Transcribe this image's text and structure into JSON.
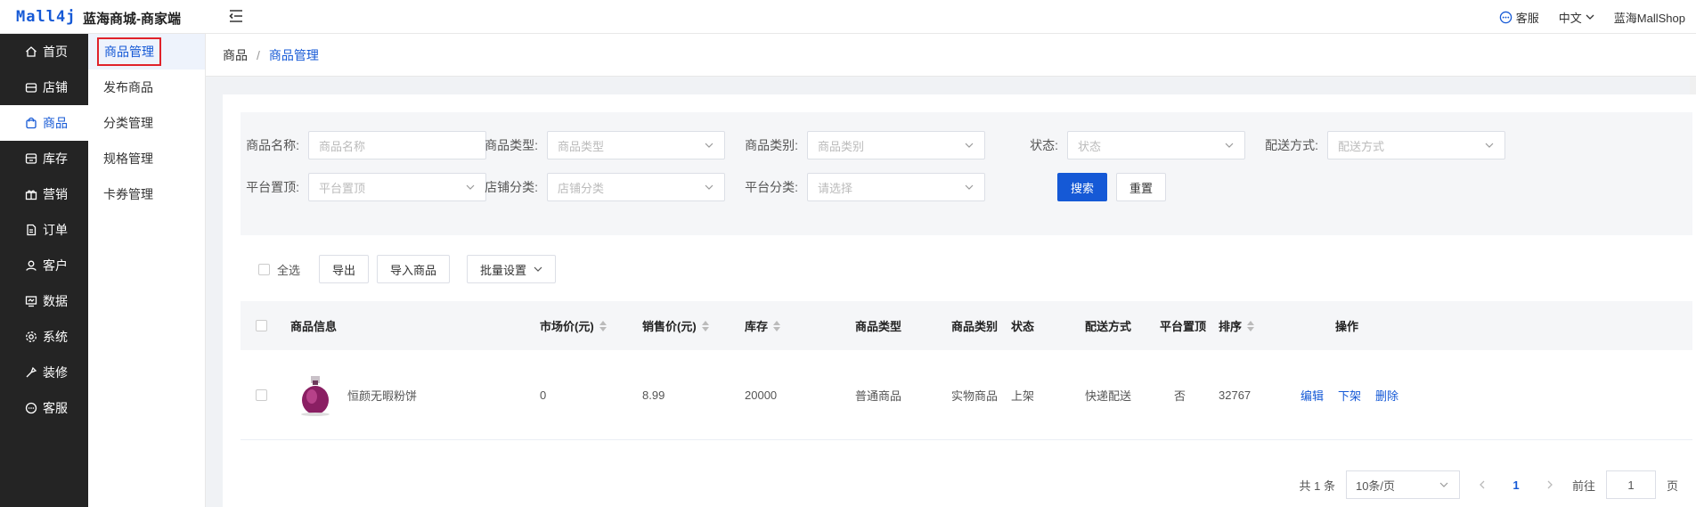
{
  "header": {
    "logo": "Mall4j",
    "shop_name": "蓝海商城-商家端",
    "service_label": "客服",
    "lang_label": "中文",
    "user_label": "蓝海MallShop"
  },
  "sidebar": {
    "items": [
      {
        "label": "首页",
        "icon": "home-icon"
      },
      {
        "label": "店铺",
        "icon": "store-icon"
      },
      {
        "label": "商品",
        "icon": "bag-icon"
      },
      {
        "label": "库存",
        "icon": "stock-icon"
      },
      {
        "label": "营销",
        "icon": "gift-icon"
      },
      {
        "label": "订单",
        "icon": "order-icon"
      },
      {
        "label": "客户",
        "icon": "user-icon"
      },
      {
        "label": "数据",
        "icon": "data-icon"
      },
      {
        "label": "系统",
        "icon": "gear-icon"
      },
      {
        "label": "装修",
        "icon": "decor-icon"
      },
      {
        "label": "客服",
        "icon": "chat-icon"
      }
    ],
    "active_index": 2
  },
  "submenu": {
    "items": [
      "商品管理",
      "发布商品",
      "分类管理",
      "规格管理",
      "卡券管理"
    ]
  },
  "breadcrumb": {
    "root": "商品",
    "sep": "/",
    "current": "商品管理"
  },
  "filters": {
    "name": {
      "label": "商品名称:",
      "placeholder": "商品名称"
    },
    "type": {
      "label": "商品类型:",
      "placeholder": "商品类型"
    },
    "category": {
      "label": "商品类别:",
      "placeholder": "商品类别"
    },
    "status": {
      "label": "状态:",
      "placeholder": "状态"
    },
    "delivery": {
      "label": "配送方式:",
      "placeholder": "配送方式"
    },
    "top": {
      "label": "平台置顶:",
      "placeholder": "平台置顶"
    },
    "shop_cat": {
      "label": "店铺分类:",
      "placeholder": "店铺分类"
    },
    "platform_cat": {
      "label": "平台分类:",
      "placeholder": "请选择"
    },
    "search_label": "搜索",
    "reset_label": "重置"
  },
  "toolbar": {
    "select_all": "全选",
    "export": "导出",
    "import": "导入商品",
    "batch": "批量设置"
  },
  "table": {
    "columns": {
      "info": "商品信息",
      "market_price": "市场价(元)",
      "sale_price": "销售价(元)",
      "stock": "库存",
      "type": "商品类型",
      "category": "商品类别",
      "status": "状态",
      "delivery": "配送方式",
      "top": "平台置顶",
      "sort": "排序",
      "ops": "操作"
    },
    "rows": [
      {
        "name": "恒颜无暇粉饼",
        "market_price": "0",
        "sale_price": "8.99",
        "stock": "20000",
        "type": "普通商品",
        "category": "实物商品",
        "status": "上架",
        "delivery": "快递配送",
        "top": "否",
        "sort": "32767",
        "op_edit": "编辑",
        "op_off": "下架",
        "op_delete": "删除"
      }
    ]
  },
  "pagination": {
    "total": "共 1 条",
    "page_size": "10条/页",
    "current_page": "1",
    "goto_label": "前往",
    "goto_value": "1",
    "page_suffix": "页"
  },
  "colors": {
    "accent": "#1559d6",
    "sidebar_bg": "#242424",
    "highlight_border": "#e0222a"
  }
}
